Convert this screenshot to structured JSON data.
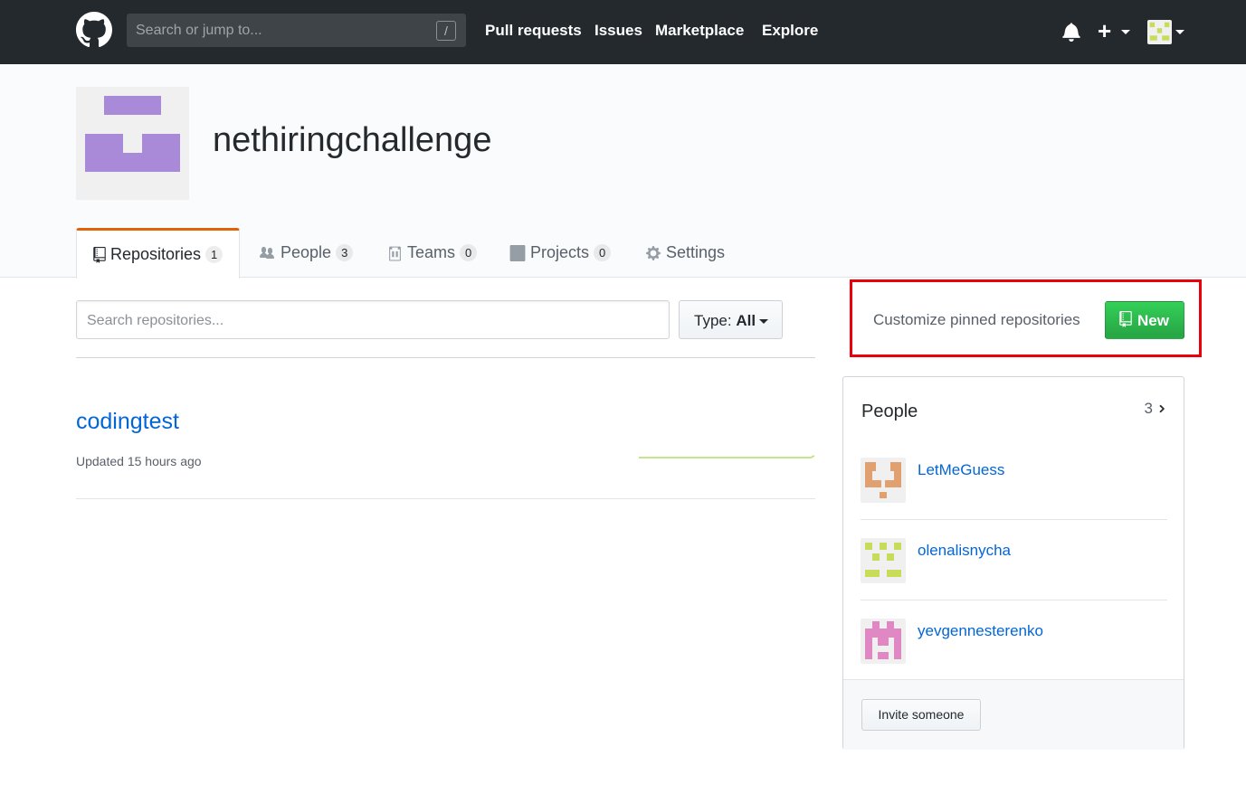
{
  "header": {
    "search_placeholder": "Search or jump to...",
    "search_shortcut": "/",
    "nav": [
      "Pull requests",
      "Issues",
      "Marketplace",
      "Explore"
    ],
    "plus_label": "+"
  },
  "org": {
    "name": "nethiringchallenge"
  },
  "tabs": [
    {
      "label": "Repositories",
      "count": "1",
      "icon": "repo-icon"
    },
    {
      "label": "People",
      "count": "3",
      "icon": "people-icon"
    },
    {
      "label": "Teams",
      "count": "0",
      "icon": "teams-icon"
    },
    {
      "label": "Projects",
      "count": "0",
      "icon": "projects-icon"
    },
    {
      "label": "Settings",
      "icon": "gear-icon"
    }
  ],
  "repo_filter": {
    "search_placeholder": "Search repositories...",
    "type_label": "Type:",
    "type_value": "All"
  },
  "repos": [
    {
      "name": "codingtest",
      "updated": "Updated 15 hours ago"
    }
  ],
  "pinned": {
    "customize_label": "Customize pinned repositories",
    "new_label": "New"
  },
  "people": {
    "title": "People",
    "count": "3",
    "members": [
      {
        "name": "LetMeGuess",
        "avatar_color": "#e0a070"
      },
      {
        "name": "olenalisnycha",
        "avatar_color": "#c8dc5a"
      },
      {
        "name": "yevgennesterenko",
        "avatar_color": "#e088c4"
      }
    ],
    "invite_label": "Invite someone"
  },
  "colors": {
    "header_bg": "#24292e",
    "link": "#0366d6",
    "active_tab_accent": "#e36209",
    "new_button": "#28a745",
    "highlight": "#e8000b",
    "org_avatar": "#a98ad9"
  }
}
